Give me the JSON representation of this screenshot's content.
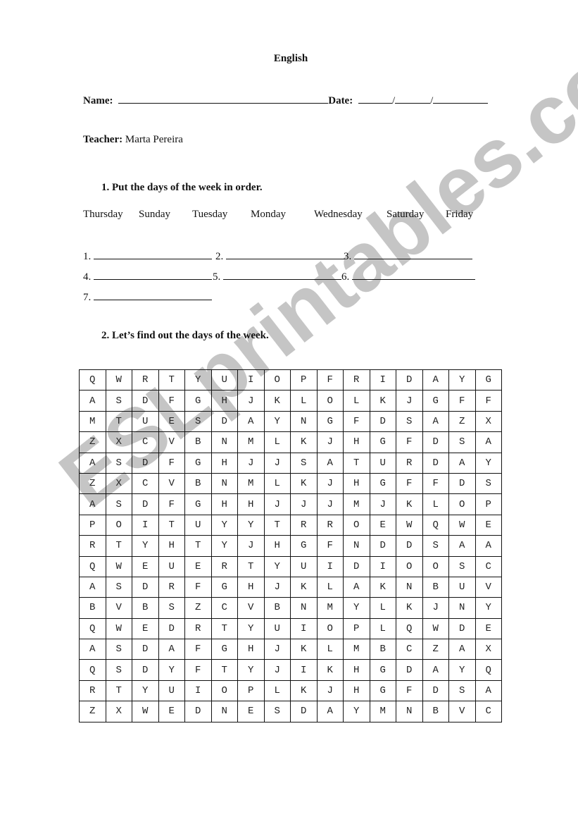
{
  "header": {
    "title": "English",
    "name_label": "Name:",
    "date_label": "Date:",
    "date_sep1": "/",
    "date_sep2": "/",
    "teacher_label": "Teacher:",
    "teacher_name": "Marta Pereira"
  },
  "section1": {
    "heading": "1.   Put the days of the week in order.",
    "days": [
      "Thursday",
      "Sunday",
      "Tuesday",
      "Monday",
      "Wednesday",
      "Saturday",
      "Friday"
    ],
    "answer_labels": [
      "1.",
      "2.",
      "3.",
      "4.",
      "5.",
      "6.",
      "7."
    ]
  },
  "section2": {
    "heading": "2.   Let’s find out the days of the week.",
    "grid": [
      [
        "Q",
        "W",
        "R",
        "T",
        "Y",
        "U",
        "I",
        "O",
        "P",
        "F",
        "R",
        "I",
        "D",
        "A",
        "Y",
        "G"
      ],
      [
        "A",
        "S",
        "D",
        "F",
        "G",
        "H",
        "J",
        "K",
        "L",
        "O",
        "L",
        "K",
        "J",
        "G",
        "F",
        "F"
      ],
      [
        "M",
        "T",
        "U",
        "E",
        "S",
        "D",
        "A",
        "Y",
        "N",
        "G",
        "F",
        "D",
        "S",
        "A",
        "Z",
        "X"
      ],
      [
        "Z",
        "X",
        "C",
        "V",
        "B",
        "N",
        "M",
        "L",
        "K",
        "J",
        "H",
        "G",
        "F",
        "D",
        "S",
        "A"
      ],
      [
        "A",
        "S",
        "D",
        "F",
        "G",
        "H",
        "J",
        "J",
        "S",
        "A",
        "T",
        "U",
        "R",
        "D",
        "A",
        "Y"
      ],
      [
        "Z",
        "X",
        "C",
        "V",
        "B",
        "N",
        "M",
        "L",
        "K",
        "J",
        "H",
        "G",
        "F",
        "F",
        "D",
        "S"
      ],
      [
        "A",
        "S",
        "D",
        "F",
        "G",
        "H",
        "H",
        "J",
        "J",
        "J",
        "M",
        "J",
        "K",
        "L",
        "O",
        "P"
      ],
      [
        "P",
        "O",
        "I",
        "T",
        "U",
        "Y",
        "Y",
        "T",
        "R",
        "R",
        "O",
        "E",
        "W",
        "Q",
        "W",
        "E"
      ],
      [
        "R",
        "T",
        "Y",
        "H",
        "T",
        "Y",
        "J",
        "H",
        "G",
        "F",
        "N",
        "D",
        "D",
        "S",
        "A",
        "A"
      ],
      [
        "Q",
        "W",
        "E",
        "U",
        "E",
        "R",
        "T",
        "Y",
        "U",
        "I",
        "D",
        "I",
        "O",
        "O",
        "S",
        "C"
      ],
      [
        "A",
        "S",
        "D",
        "R",
        "F",
        "G",
        "H",
        "J",
        "K",
        "L",
        "A",
        "K",
        "N",
        "B",
        "U",
        "V"
      ],
      [
        "B",
        "V",
        "B",
        "S",
        "Z",
        "C",
        "V",
        "B",
        "N",
        "M",
        "Y",
        "L",
        "K",
        "J",
        "N",
        "Y"
      ],
      [
        "Q",
        "W",
        "E",
        "D",
        "R",
        "T",
        "Y",
        "U",
        "I",
        "O",
        "P",
        "L",
        "Q",
        "W",
        "D",
        "E"
      ],
      [
        "A",
        "S",
        "D",
        "A",
        "F",
        "G",
        "H",
        "J",
        "K",
        "L",
        "M",
        "B",
        "C",
        "Z",
        "A",
        "X"
      ],
      [
        "Q",
        "S",
        "D",
        "Y",
        "F",
        "T",
        "Y",
        "J",
        "I",
        "K",
        "H",
        "G",
        "D",
        "A",
        "Y",
        "Q"
      ],
      [
        "R",
        "T",
        "Y",
        "U",
        "I",
        "O",
        "P",
        "L",
        "K",
        "J",
        "H",
        "G",
        "F",
        "D",
        "S",
        "A"
      ],
      [
        "Z",
        "X",
        "W",
        "E",
        "D",
        "N",
        "E",
        "S",
        "D",
        "A",
        "Y",
        "M",
        "N",
        "B",
        "V",
        "C"
      ]
    ]
  },
  "watermark": "ESLprintables.com"
}
